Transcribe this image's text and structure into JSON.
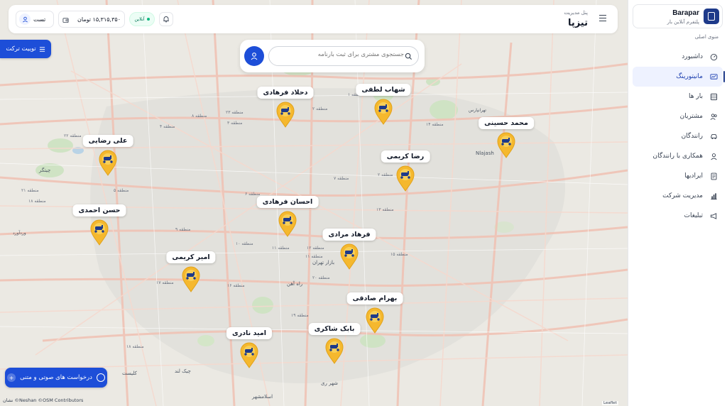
{
  "app": {
    "brand_name": "Barapar",
    "brand_subtitle": "پلتفرم آنلاین بار"
  },
  "sidebar": {
    "menu_title": "منوی اصلی",
    "items": [
      {
        "label": "داشبورد",
        "icon": "dashboard-icon",
        "active": false
      },
      {
        "label": "مانیتورینگ",
        "icon": "monitor-icon",
        "active": true
      },
      {
        "label": "بار ها",
        "icon": "cargo-icon",
        "active": false
      },
      {
        "label": "مشتریان",
        "icon": "customers-icon",
        "active": false
      },
      {
        "label": "رانندگان",
        "icon": "car-icon",
        "active": false
      },
      {
        "label": "همکاری با رانندگان",
        "icon": "user-icon",
        "active": false
      },
      {
        "label": "ایرادیها",
        "icon": "document-icon",
        "active": false
      },
      {
        "label": "مدیریت شرکت",
        "icon": "chart-icon",
        "active": false
      },
      {
        "label": "تبلیغات",
        "icon": "megaphone-icon",
        "active": false
      }
    ]
  },
  "header": {
    "subtitle": "پنل مدیریت",
    "title": "تیزپا",
    "user_name": "تست",
    "wallet_amount": "۱۵,۳۱۵,۳۵۰ تومان",
    "status_label": "آنلاین"
  },
  "search": {
    "placeholder": "جستجوی مشتری برای ثبت بارنامه"
  },
  "buttons": {
    "track_label": "توییت ترکت",
    "voice_label": "درخواست های صوتی و متنی"
  },
  "drivers": [
    {
      "name": "دحلاد فرهادی"
    },
    {
      "name": "شهاب لطفی"
    },
    {
      "name": "محمد حسینی"
    },
    {
      "name": "علی رضایی"
    },
    {
      "name": "رضا کریمی"
    },
    {
      "name": "احسان فرهادی"
    },
    {
      "name": "حسن احمدی"
    },
    {
      "name": "فرهاد مرادی"
    },
    {
      "name": "امیر کریمی"
    },
    {
      "name": "بهرام صادقی"
    },
    {
      "name": "بابک شاکری"
    },
    {
      "name": "امید نادری"
    }
  ],
  "map": {
    "attribution": "©Neshan ©OSM Contributors",
    "attribution_brand": "نشان",
    "leaflet": "Leaflet",
    "districts": [
      "منطقه ۴",
      "منطقه ۳",
      "منطقه ۲",
      "منطقه ۱۴",
      "منطقه ۱۳",
      "منطقه ۹",
      "منطقه ۱۰",
      "منطقه ۱۱",
      "منطقه ۱۲",
      "منطقه ۱۶",
      "منطقه ۱۷",
      "منطقه ۱۹",
      "منطقه ۲۲",
      "منطقه ۵",
      "منطقه ۶",
      "منطقه ۷",
      "منطقه ۸",
      "منطقه ۱۵",
      "منطقه ۲۰",
      "منطقه ۱۸",
      "منطقه ۲۱",
      "منطقه ۱",
      "منطقه ۲۳",
      "منطقه ۱۸",
      "منطقه ۲",
      "منطقه ۱۱"
    ],
    "places": [
      "چیتگر",
      "بازار تهران",
      "راه آهن",
      "شهر ری",
      "چیک لند",
      "کلیست",
      "Nlajash",
      "تهرانپارس",
      "اسلامشهر",
      "وردآورد"
    ]
  },
  "colors": {
    "primary": "#1d4ed8",
    "sidebar_active_bg": "#eef2ff",
    "pin_yellow": "#f5b82e",
    "online_green": "#10b981"
  }
}
